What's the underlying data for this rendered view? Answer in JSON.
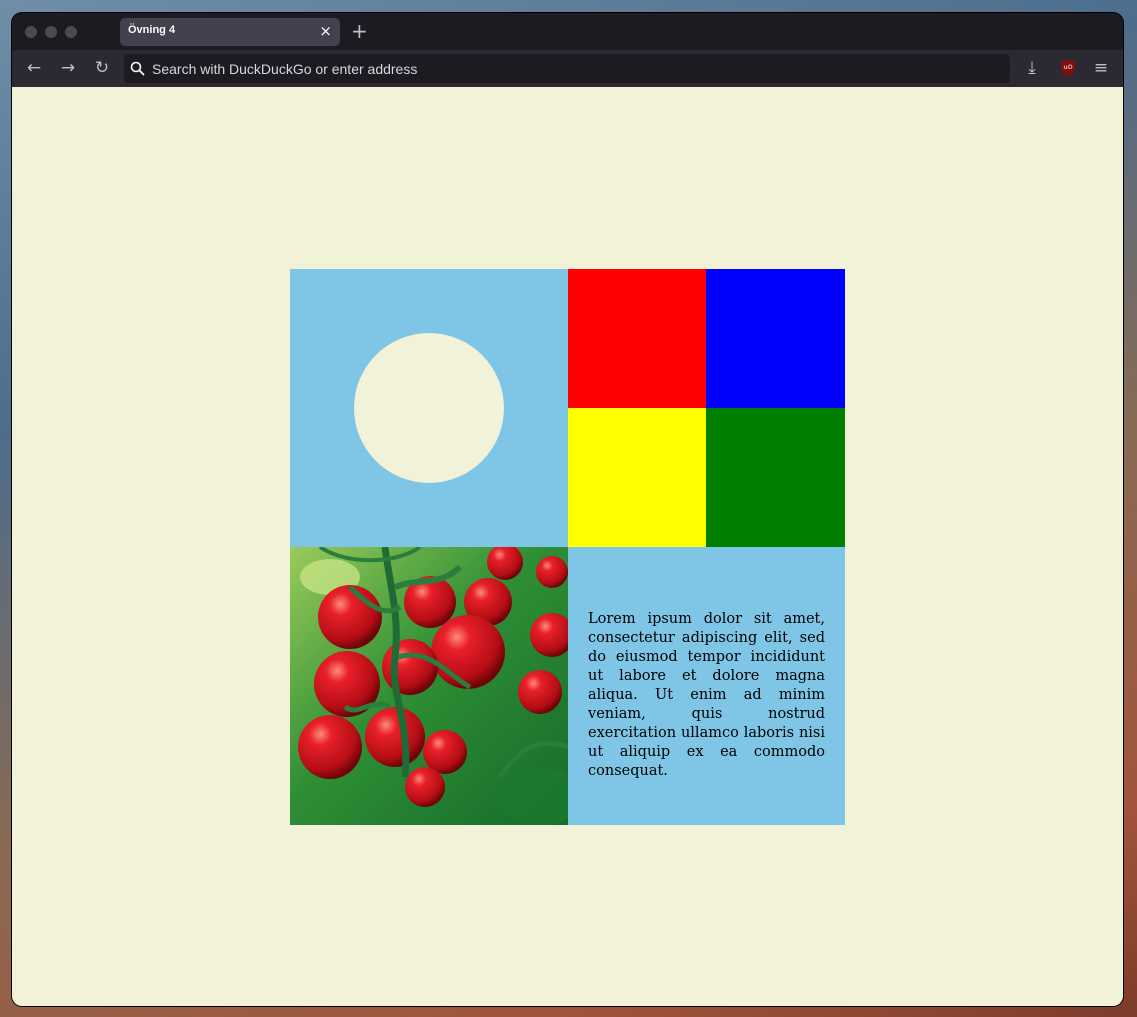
{
  "browser": {
    "tab_title": "Övning 4",
    "tab_close_glyph": "×",
    "new_tab_glyph": "+",
    "back_glyph": "←",
    "forward_glyph": "→",
    "reload_glyph": "↻",
    "address_placeholder": "Search with DuckDuckGo or enter address",
    "address_value": "",
    "download_glyph": "⤓",
    "menu_glyph": "≡",
    "extension_badge": "uO",
    "icons": [
      "back-arrow-icon",
      "forward-arrow-icon",
      "reload-icon",
      "search-icon",
      "download-icon",
      "ublock-origin-icon",
      "hamburger-menu-icon"
    ]
  },
  "page": {
    "background_color": "#f2f2d8",
    "quadrants": {
      "top_left": {
        "background": "#7ec5e6",
        "circle_color": "#f2f2d8"
      },
      "top_right": {
        "colors": [
          "#ff0000",
          "#0000ff",
          "#ffff00",
          "#008000"
        ]
      },
      "bottom_left": {
        "image": "cherry-tomatoes-on-vine"
      },
      "bottom_right": {
        "background": "#7ec5e6",
        "text": "Lorem ipsum dolor sit amet, consectetur adipiscing elit, sed do eiusmod tempor incididunt ut labore et dolore magna aliqua. Ut enim ad minim veniam, quis nostrud exercitation ullamco laboris nisi ut aliquip ex ea commodo consequat."
      }
    }
  }
}
